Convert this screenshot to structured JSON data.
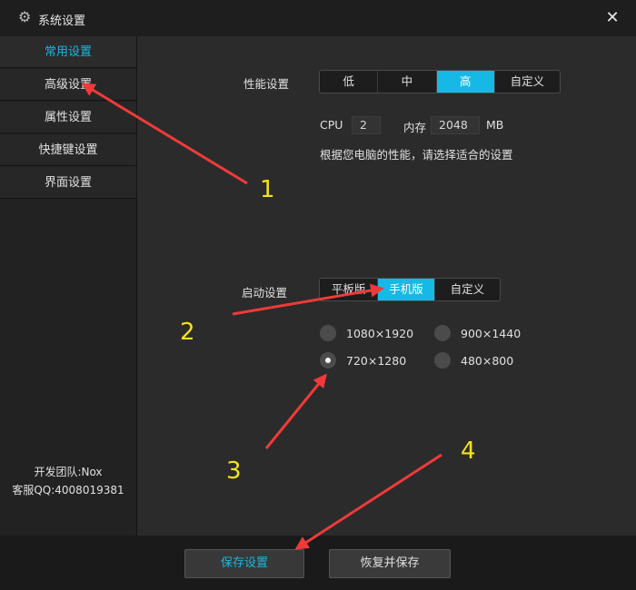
{
  "window": {
    "title": "系统设置",
    "icon": "gear-icon",
    "close_glyph": "✕"
  },
  "sidebar": {
    "items": [
      {
        "label": "常用设置",
        "active": true
      },
      {
        "label": "高级设置",
        "active": false
      },
      {
        "label": "属性设置",
        "active": false
      },
      {
        "label": "快捷键设置",
        "active": false
      },
      {
        "label": "界面设置",
        "active": false
      }
    ],
    "footer_team": "开发团队:Nox",
    "footer_qq": "客服QQ:4008019381"
  },
  "performance": {
    "label": "性能设置",
    "options": [
      "低",
      "中",
      "高",
      "自定义"
    ],
    "selected": "高",
    "cpu_label": "CPU",
    "cpu_value": "2",
    "mem_label": "内存",
    "mem_value": "2048",
    "mem_unit": "MB",
    "hint": "根据您电脑的性能，请选择适合的设置"
  },
  "startup": {
    "label": "启动设置",
    "options": [
      "平板版",
      "手机版",
      "自定义"
    ],
    "selected": "手机版",
    "resolutions": [
      "1080×1920",
      "900×1440",
      "720×1280",
      "480×800"
    ],
    "selected_resolution": "720×1280"
  },
  "buttons": {
    "save": "保存设置",
    "restore_save": "恢复并保存"
  },
  "annotations": {
    "numbers": [
      "1",
      "2",
      "3",
      "4"
    ],
    "arrow_color": "#f03a3a",
    "number_color": "#f6e11a"
  },
  "colors": {
    "accent": "#16b9e5"
  }
}
